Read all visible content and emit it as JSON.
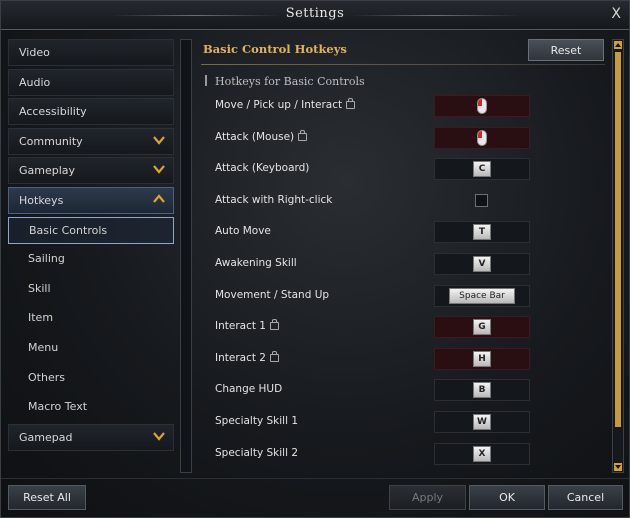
{
  "window": {
    "title": "Settings",
    "close_label": "X"
  },
  "sidebar": {
    "items": [
      {
        "label": "Video"
      },
      {
        "label": "Audio"
      },
      {
        "label": "Accessibility"
      },
      {
        "label": "Community",
        "chevron": "v"
      },
      {
        "label": "Gameplay",
        "chevron": "v"
      },
      {
        "label": "Hotkeys",
        "chevron": "^"
      }
    ],
    "subitems": [
      {
        "label": "Basic Controls"
      },
      {
        "label": "Sailing"
      },
      {
        "label": "Skill"
      },
      {
        "label": "Item"
      },
      {
        "label": "Menu"
      },
      {
        "label": "Others"
      },
      {
        "label": "Macro Text"
      }
    ],
    "gamepad": {
      "label": "Gamepad",
      "chevron": "v"
    }
  },
  "main": {
    "title": "Basic Control Hotkeys",
    "reset_label": "Reset",
    "subheading": "Hotkeys for Basic Controls",
    "rows": [
      {
        "name": "Move / Pick up / Interact",
        "binding": "mouse-left",
        "locked": true
      },
      {
        "name": "Attack (Mouse)",
        "binding": "mouse-left",
        "locked": true
      },
      {
        "name": "Attack (Keyboard)",
        "binding": "C"
      },
      {
        "name": "Attack with Right-click",
        "binding": "checkbox"
      },
      {
        "name": "Auto Move",
        "binding": "T"
      },
      {
        "name": "Awakening Skill",
        "binding": "V"
      },
      {
        "name": "Movement / Stand Up",
        "binding": "Space Bar"
      },
      {
        "name": "Interact 1",
        "binding": "G",
        "locked": true
      },
      {
        "name": "Interact 2",
        "binding": "H",
        "locked": true
      },
      {
        "name": "Change HUD",
        "binding": "B"
      },
      {
        "name": "Specialty Skill 1",
        "binding": "W"
      },
      {
        "name": "Specialty Skill 2",
        "binding": "X"
      }
    ]
  },
  "footer": {
    "reset_all": "Reset All",
    "apply": "Apply",
    "ok": "OK",
    "cancel": "Cancel"
  },
  "colors": {
    "accent": "#d9a435",
    "title_gold": "#e2b35b",
    "locked_slot": "#2a0f12"
  }
}
